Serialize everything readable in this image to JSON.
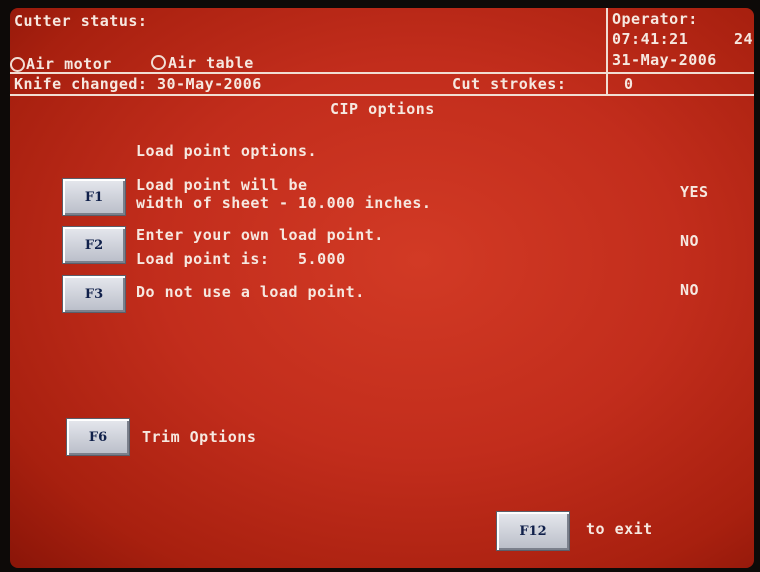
{
  "header": {
    "cutter_status_label": "Cutter status:",
    "operator_label": "Operator:",
    "time": "07:41:21",
    "time_suffix": "24",
    "date": "31-May-2006",
    "air_motor_label": "Air motor",
    "air_table_label": "Air table",
    "knife_changed_label": "Knife changed: 30-May-2006",
    "cut_strokes_label": "Cut strokes:",
    "cut_strokes_value": "0"
  },
  "title": "CIP options",
  "section_heading": "Load point options.",
  "options": [
    {
      "key": "F1",
      "line1": "Load point will be",
      "line2": "width of sheet - 10.000 inches.",
      "value": "YES"
    },
    {
      "key": "F2",
      "line1": "Enter your own load point.",
      "line2": "Load point is:   5.000",
      "value": "NO"
    },
    {
      "key": "F3",
      "line1": "Do not use a load point.",
      "value": "NO"
    }
  ],
  "trim": {
    "key": "F6",
    "label": "Trim Options"
  },
  "exit": {
    "key": "F12",
    "label": "to exit"
  }
}
